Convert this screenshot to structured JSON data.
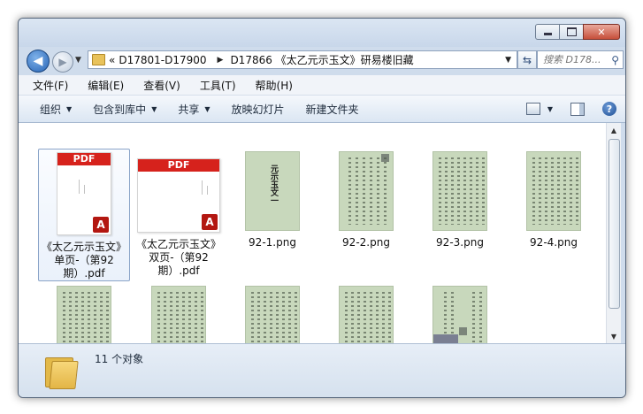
{
  "window": {
    "buttons": {
      "minimize": "minimize",
      "maximize": "maximize",
      "close": "✕"
    }
  },
  "navigation": {
    "back_glyph": "◀",
    "forward_glyph": "▶",
    "breadcrumb": [
      "D17801-D17900",
      "D17866 《太乙元示玉文》研易楼旧藏"
    ],
    "overflow": "«",
    "search_placeholder": "搜索 D178..."
  },
  "menu": [
    "文件(F)",
    "编辑(E)",
    "查看(V)",
    "工具(T)",
    "帮助(H)"
  ],
  "toolbar": {
    "organize": "组织",
    "include_in_library": "包含到库中",
    "share": "共享",
    "slideshow": "放映幻灯片",
    "new_folder": "新建文件夹"
  },
  "files": [
    {
      "name": "《太乙元示玉文》单页-（第92期）.pdf",
      "kind": "pdf",
      "badge": "PDF",
      "selected": true
    },
    {
      "name": "《太乙元示玉文》双页-（第92期）.pdf",
      "kind": "pdf",
      "badge": "PDF",
      "selected": false
    },
    {
      "name": "92-1.png",
      "kind": "png",
      "cover_title": "元示玉文一"
    },
    {
      "name": "92-2.png",
      "kind": "png"
    },
    {
      "name": "92-3.png",
      "kind": "png"
    },
    {
      "name": "92-4.png",
      "kind": "png"
    },
    {
      "name": "",
      "kind": "png"
    },
    {
      "name": "",
      "kind": "png"
    },
    {
      "name": "",
      "kind": "png"
    },
    {
      "name": "",
      "kind": "png"
    },
    {
      "name": "",
      "kind": "png"
    }
  ],
  "status": {
    "count_text": "11 个对象"
  },
  "colors": {
    "accent": "#2764b5",
    "pdf_red": "#d6221c",
    "thumb_green": "#c8d8bc"
  }
}
